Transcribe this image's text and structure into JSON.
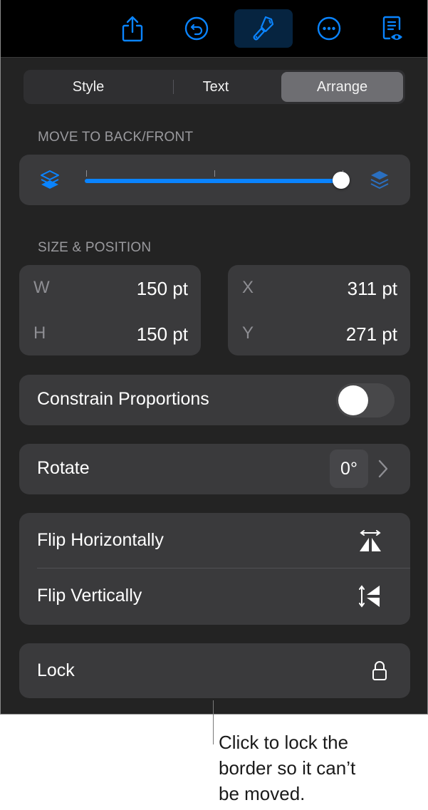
{
  "toolbar": {
    "buttons": [
      {
        "name": "share",
        "icon": "share-icon"
      },
      {
        "name": "undo",
        "icon": "undo-icon"
      },
      {
        "name": "format",
        "icon": "paintbrush-icon",
        "active": true
      },
      {
        "name": "more",
        "icon": "more-icon"
      },
      {
        "name": "reading-view",
        "icon": "document-eye-icon"
      }
    ],
    "accent_color": "#0a84ff"
  },
  "tabs": [
    {
      "label": "Style",
      "active": false
    },
    {
      "label": "Text",
      "active": false
    },
    {
      "label": "Arrange",
      "active": true
    }
  ],
  "move_section": {
    "label": "MOVE TO BACK/FRONT",
    "slider_value_fraction": 1.0,
    "back_icon": "send-to-back-icon",
    "front_icon": "bring-to-front-icon"
  },
  "size_section": {
    "label": "SIZE & POSITION",
    "w_label": "W",
    "w_value": "150 pt",
    "h_label": "H",
    "h_value": "150 pt",
    "x_label": "X",
    "x_value": "311 pt",
    "y_label": "Y",
    "y_value": "271 pt"
  },
  "constrain": {
    "label": "Constrain Proportions",
    "on": false
  },
  "rotate": {
    "label": "Rotate",
    "value": "0°"
  },
  "flip": {
    "horizontal_label": "Flip Horizontally",
    "vertical_label": "Flip Vertically"
  },
  "lock": {
    "label": "Lock"
  },
  "callout": {
    "text": "Click to lock the border so it can’t be moved."
  }
}
